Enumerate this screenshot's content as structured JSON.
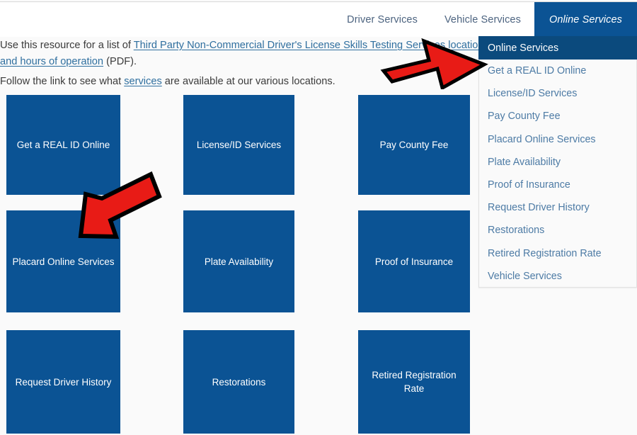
{
  "nav": {
    "tabs": [
      {
        "label": "Driver Services",
        "active": false
      },
      {
        "label": "Vehicle Services",
        "active": false
      },
      {
        "label": "Online Services",
        "active": true
      }
    ]
  },
  "content": {
    "paragraph1": {
      "before": "Use this resource for a list of ",
      "link": "Third Party Non-Commercial Driver's License Skills Testing Services locations and hours of operation",
      "after": " (PDF)."
    },
    "paragraph2": {
      "before": "Follow the link to see what ",
      "link": "services",
      "after": " are available at our various locations."
    }
  },
  "tiles": [
    {
      "label": "Get a REAL ID Online"
    },
    {
      "label": "License/ID Services"
    },
    {
      "label": "Pay County Fee"
    },
    {
      "label": "Placard Online Services"
    },
    {
      "label": "Plate Availability"
    },
    {
      "label": "Proof of Insurance"
    },
    {
      "label": "Request Driver History"
    },
    {
      "label": "Restorations"
    },
    {
      "label": "Retired Registration Rate"
    }
  ],
  "dropdown": {
    "items": [
      {
        "label": "Online Services",
        "active": true
      },
      {
        "label": "Get a REAL ID Online",
        "active": false
      },
      {
        "label": "License/ID Services",
        "active": false
      },
      {
        "label": "Pay County Fee",
        "active": false
      },
      {
        "label": "Placard Online Services",
        "active": false
      },
      {
        "label": "Plate Availability",
        "active": false
      },
      {
        "label": "Proof of Insurance",
        "active": false
      },
      {
        "label": "Request Driver History",
        "active": false
      },
      {
        "label": "Restorations",
        "active": false
      },
      {
        "label": "Retired Registration Rate",
        "active": false
      },
      {
        "label": "Vehicle Services",
        "active": false
      }
    ]
  },
  "annotations": [
    {
      "name": "arrow-to-dropdown",
      "direction": "right"
    },
    {
      "name": "arrow-to-placard-tile",
      "direction": "down-left"
    }
  ],
  "colors": {
    "tile_blue": "#0b5394",
    "active_tab_blue": "#0b5394",
    "dropdown_active_blue": "#0b4a7d",
    "link_blue": "#2f6f9f",
    "dropdown_text_blue": "#4d7ba5",
    "annotation_red": "#e81b16",
    "page_background": "#fafafa"
  }
}
